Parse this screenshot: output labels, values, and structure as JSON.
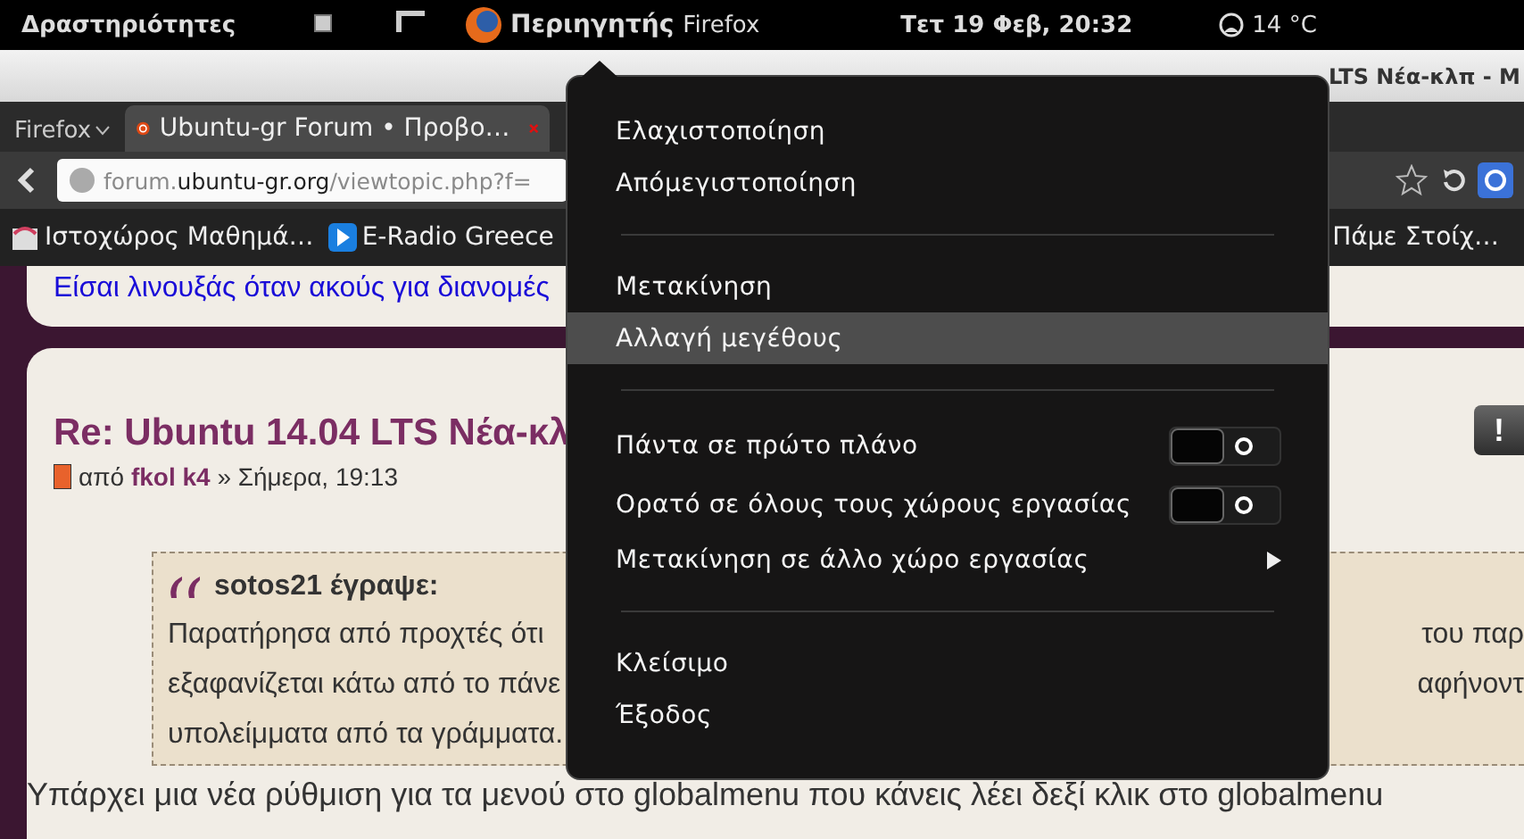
{
  "top_panel": {
    "activities": "Δραστηριότητες",
    "app_name": "Περιηγητής",
    "app_sub": "Firefox",
    "clock": "Τετ 19 Φεβ, 20:32",
    "weather": "14 °C"
  },
  "window": {
    "title_visible": "LTS Νέα-κλπ - Μ"
  },
  "tabs": {
    "menu_button": "Firefox",
    "items": [
      {
        "label": "Ubuntu-gr Forum • Προβο…",
        "selected": true
      }
    ]
  },
  "address_bar": {
    "host_prefix": "forum.",
    "host": "ubuntu-gr.org",
    "path": "/viewtopic.php?f="
  },
  "bookmarks": [
    {
      "label": "Ιστοχώρος Μαθημά…",
      "kind": "page"
    },
    {
      "label": "E-Radio Greece",
      "kind": "play"
    },
    {
      "label": "Πάμε Στοίχ…",
      "kind": "plain"
    }
  ],
  "page": {
    "signature_link": "Είσαι λινουξάς όταν ακούς για διανομές",
    "post": {
      "report": "!",
      "title": "Re: Ubuntu 14.04 LTS Νέα-κλ",
      "by": "από",
      "author": "fkol k4",
      "date": "» Σήμερα, 19:13",
      "quote": {
        "author": "sotos21 έγραψε:",
        "lines": [
          {
            "left": "Παρατήρησα από προχτές ότι",
            "right": "του παρ"
          },
          {
            "left": "εξαφανίζεται κάτω από το πάνε",
            "right": "αφήνοντ"
          },
          {
            "left": "υπολείμματα από τα γράμματα."
          }
        ]
      },
      "body": "Υπάρχει μια νέα ρύθμιση για τα μενού στο globalmenu που κάνεις λέει δεξί κλικ στο globalmenu"
    }
  },
  "window_menu": [
    {
      "kind": "item",
      "label": "Ελαχιστοποίηση",
      "selected": false
    },
    {
      "kind": "item",
      "label": "Απόμεγιστοποίηση",
      "selected": false
    },
    {
      "kind": "separator"
    },
    {
      "kind": "item",
      "label": "Μετακίνηση",
      "selected": false
    },
    {
      "kind": "item",
      "label": "Αλλαγή μεγέθους",
      "selected": true
    },
    {
      "kind": "separator"
    },
    {
      "kind": "toggle",
      "label": "Πάντα σε πρώτο πλάνο",
      "on": false
    },
    {
      "kind": "toggle",
      "label": "Ορατό σε όλους τους χώρους εργασίας",
      "on": false
    },
    {
      "kind": "submenu",
      "label": "Μετακίνηση σε άλλο χώρο εργασίας"
    },
    {
      "kind": "separator"
    },
    {
      "kind": "item",
      "label": "Κλείσιμο",
      "selected": false
    },
    {
      "kind": "item",
      "label": "Έξοδος",
      "selected": false
    }
  ]
}
